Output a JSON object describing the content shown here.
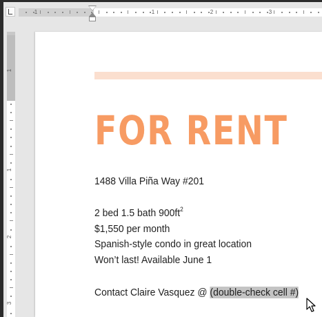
{
  "ruler": {
    "horizontal_numbers": [
      "1",
      "1",
      "2",
      "3"
    ],
    "vertical_numbers": [
      "1",
      "1",
      "2",
      "3"
    ]
  },
  "document": {
    "title": "FOR RENT",
    "address": "1488 Villa Piña Way #201",
    "details_main": "2 bed 1.5 bath 900ft",
    "details_sup": "2",
    "price": "$1,550 per month",
    "description": "Spanish-style condo in great location",
    "availability": "Won’t last! Available June 1",
    "contact_prefix": "Contact Claire Vasquez @ ",
    "contact_highlight": "(double-check cell #)"
  },
  "colors": {
    "accent": "#f79b63",
    "header_bar": "#fbdfcf",
    "highlight": "#c4c4c4"
  },
  "icons": {
    "tab_selector": "left-tab-icon",
    "cursor": "mouse-pointer-icon"
  }
}
